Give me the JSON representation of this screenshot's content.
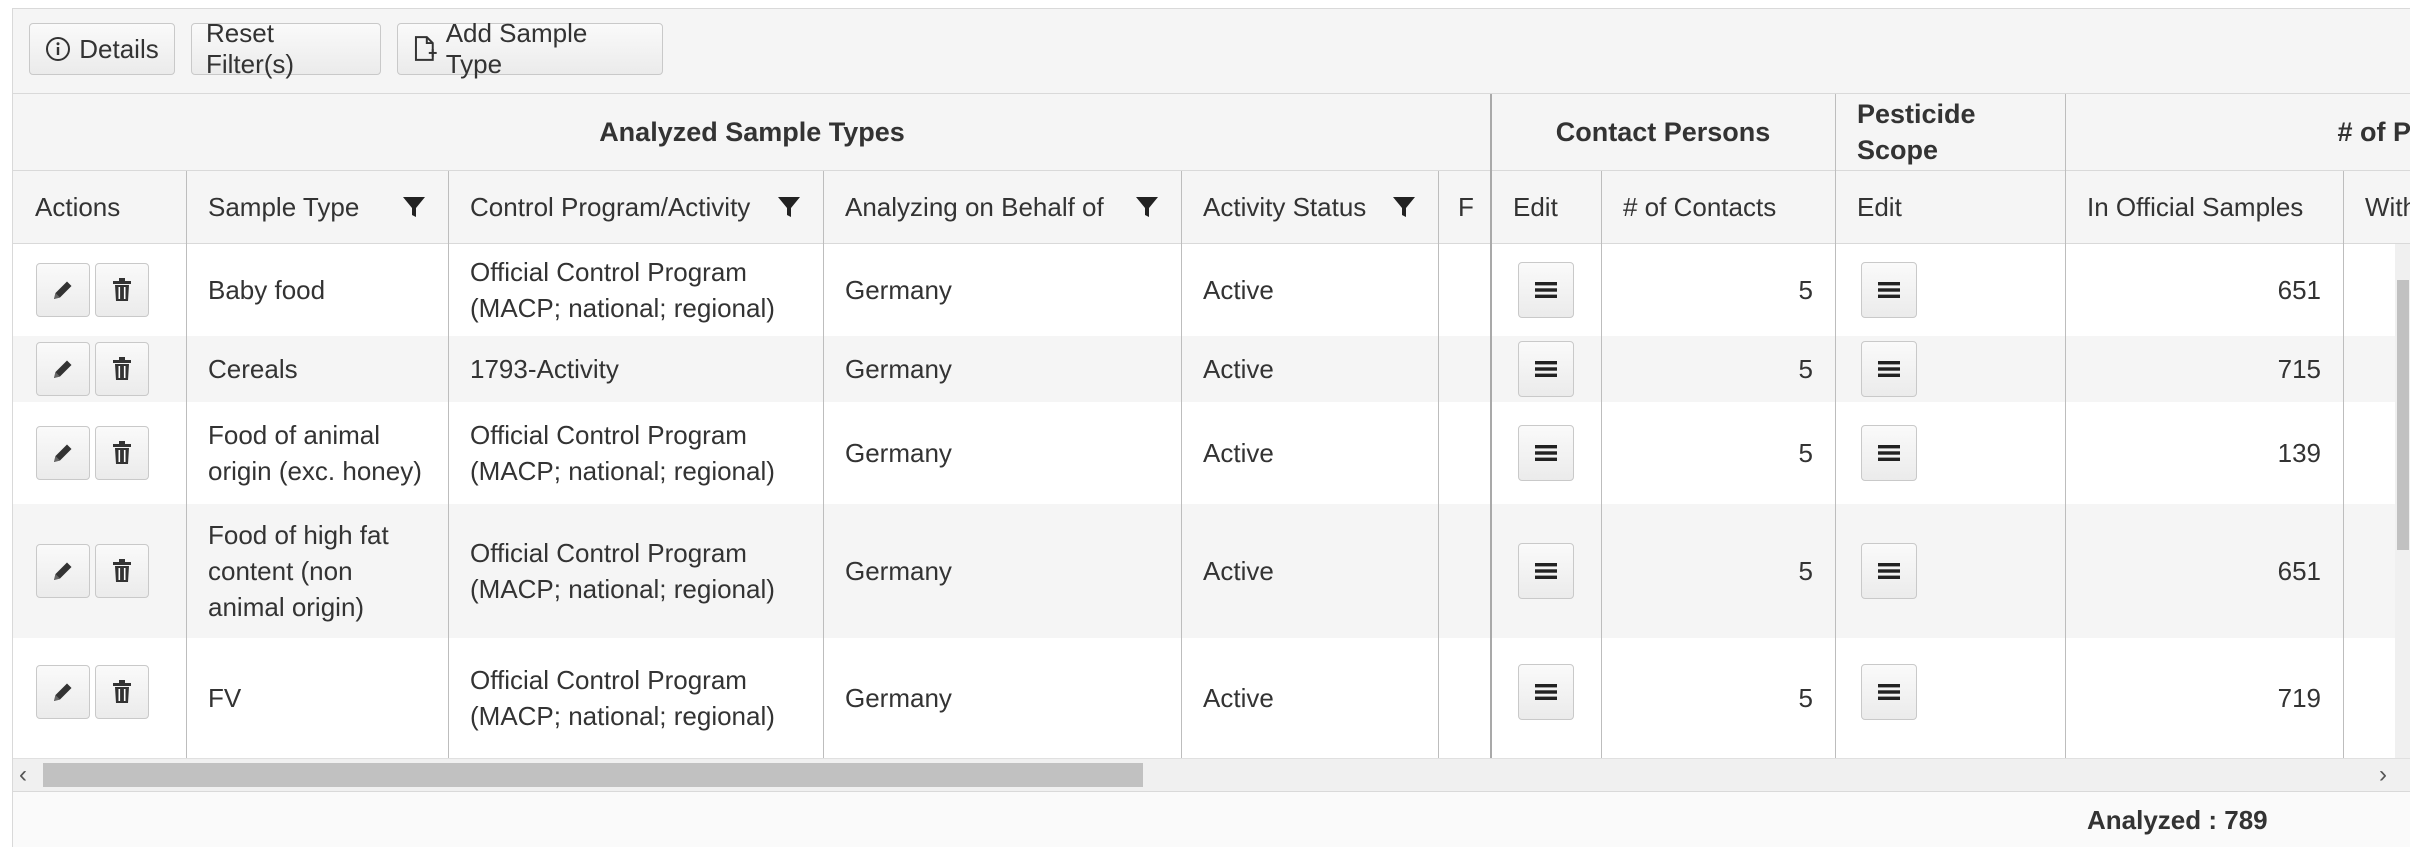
{
  "toolbar": {
    "details_label": "Details",
    "reset_label": "Reset Filter(s)",
    "add_label": "Add Sample Type"
  },
  "groups": {
    "analyzed": "Analyzed Sample Types",
    "contacts": "Contact Persons",
    "pesticide": "Pesticide Scope",
    "count": "# of P"
  },
  "columns": {
    "actions": "Actions",
    "sample_type": "Sample Type",
    "control_program": "Control Program/Activity",
    "behalf": "Analyzing on Behalf of",
    "status": "Activity Status",
    "partial": "F",
    "contacts_edit": "Edit",
    "num_contacts": "# of Contacts",
    "pesticide_edit": "Edit",
    "official": "In Official Samples",
    "with": "With"
  },
  "rows": [
    {
      "sample_type": "Baby food",
      "control_program": "Official Control Program (MACP; national; regional)",
      "behalf": "Germany",
      "status": "Active",
      "contacts": "5",
      "official": "651"
    },
    {
      "sample_type": "Cereals",
      "control_program": "1793-Activity",
      "behalf": "Germany",
      "status": "Active",
      "contacts": "5",
      "official": "715"
    },
    {
      "sample_type": "Food of animal origin (exc. honey)",
      "control_program": "Official Control Program (MACP; national; regional)",
      "behalf": "Germany",
      "status": "Active",
      "contacts": "5",
      "official": "139"
    },
    {
      "sample_type": "Food of high fat content (non animal origin)",
      "control_program": "Official Control Program (MACP; national; regional)",
      "behalf": "Germany",
      "status": "Active",
      "contacts": "5",
      "official": "651"
    },
    {
      "sample_type": "FV",
      "control_program": "Official Control Program (MACP; national; regional)",
      "behalf": "Germany",
      "status": "Active",
      "contacts": "5",
      "official": "719"
    }
  ],
  "footer": {
    "analyzed": "Analyzed : 789"
  },
  "icons": {
    "details": "info-circle-icon",
    "add": "add-document-icon",
    "filter": "filter-funnel-icon",
    "edit": "pencil-icon",
    "delete": "trash-icon",
    "menu": "hamburger-menu-icon"
  }
}
